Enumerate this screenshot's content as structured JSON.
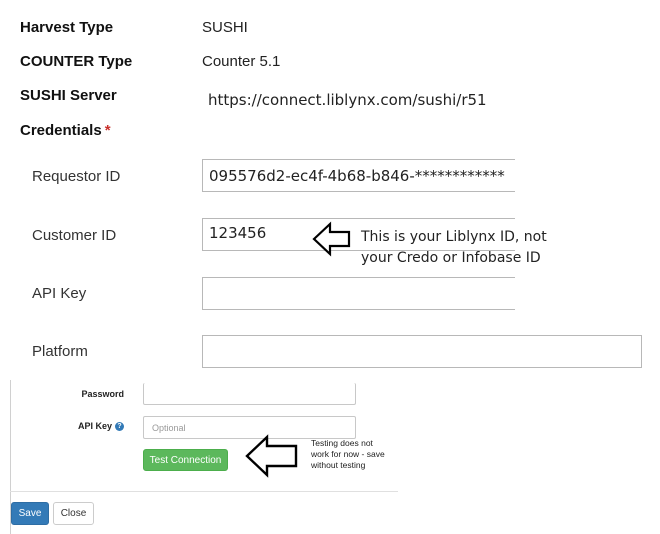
{
  "harvest": {
    "label": "Harvest Type",
    "value": "SUSHI"
  },
  "counter": {
    "label": "COUNTER Type",
    "value": "Counter 5.1"
  },
  "server": {
    "label": "SUSHI Server",
    "value": "https://connect.liblynx.com/sushi/r51"
  },
  "credentials": {
    "label": "Credentials",
    "required_mark": "*"
  },
  "requestor": {
    "label": "Requestor ID",
    "value": "095576d2-ec4f-4b68-b846-************"
  },
  "customer": {
    "label": "Customer ID",
    "value": "123456",
    "annotation_line1": "This is your Liblynx ID, not",
    "annotation_line2": "your Credo or Infobase ID"
  },
  "api_key_large": {
    "label": "API Key",
    "value": ""
  },
  "platform": {
    "label": "Platform",
    "value": ""
  },
  "password": {
    "label": "Password",
    "value": ""
  },
  "api_key_small": {
    "label": "API Key",
    "placeholder": "Optional",
    "help_icon": "question-circle-icon"
  },
  "test": {
    "button_label": "Test Connection",
    "annotation_line1": "Testing does not",
    "annotation_line2": "work for now - save",
    "annotation_line3": "without testing"
  },
  "footer": {
    "save_label": "Save",
    "close_label": "Close"
  },
  "colors": {
    "green": "#5cb85c",
    "blue": "#337ab7",
    "required": "#c9302c"
  }
}
